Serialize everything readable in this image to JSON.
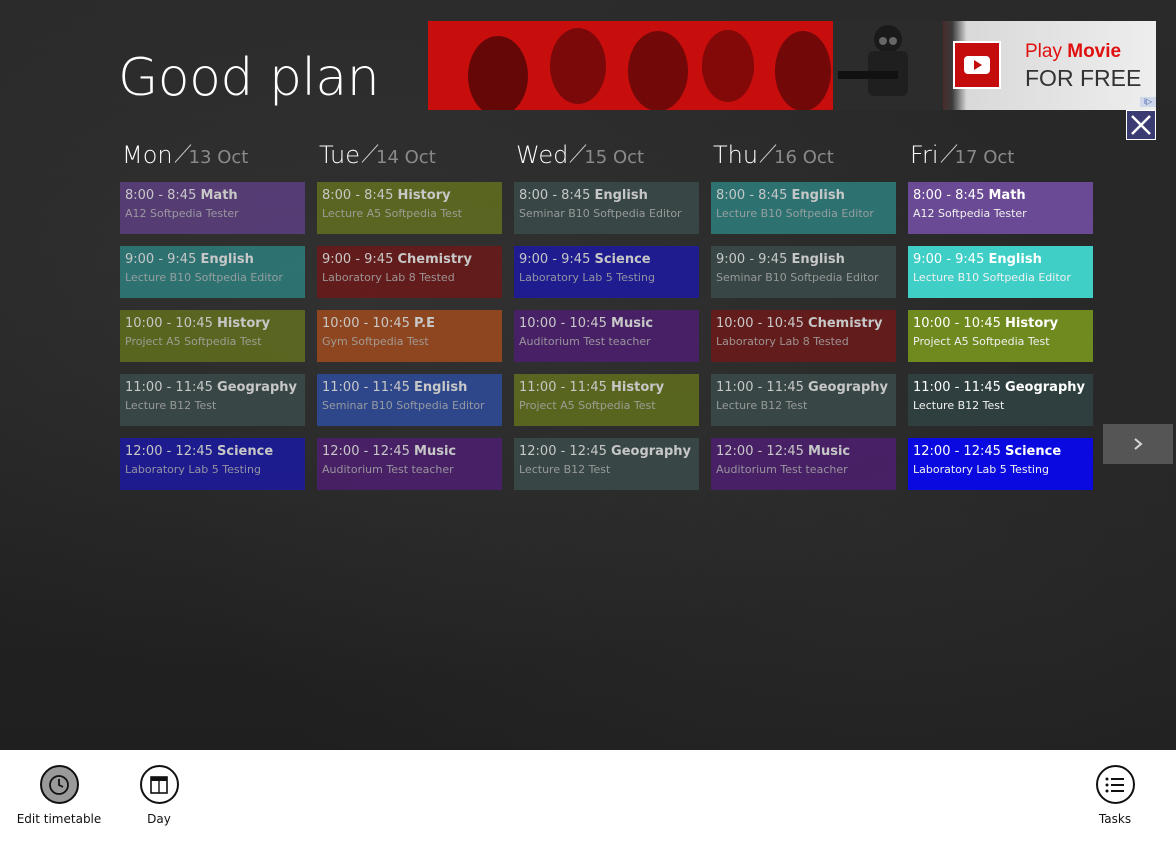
{
  "app": {
    "title": "Good plan"
  },
  "ad": {
    "line1_a": "Play",
    "line1_b": "Movie",
    "line2": "FOR FREE",
    "info_label": "i▷"
  },
  "days": [
    {
      "name": "Mon",
      "date": "13 Oct",
      "lessons": [
        {
          "time": "8:00 - 8:45",
          "subject": "Math",
          "details": "A12 Softpedia Tester",
          "color": "#5b3f7d"
        },
        {
          "time": "9:00 - 9:45",
          "subject": "English",
          "details": "Lecture B10 Softpedia Editor",
          "color": "#2e7b7b"
        },
        {
          "time": "10:00 - 10:45",
          "subject": "History",
          "details": "Project A5 Softpedia Test",
          "color": "#5f6d1e"
        },
        {
          "time": "11:00 - 11:45",
          "subject": "Geography",
          "details": "Lecture B12 Test",
          "color": "#3a4a4a"
        },
        {
          "time": "12:00 - 12:45",
          "subject": "Science",
          "details": "Laboratory Lab 5 Testing",
          "color": "#1c1a9c"
        }
      ]
    },
    {
      "name": "Tue",
      "date": "14 Oct",
      "lessons": [
        {
          "time": "8:00 - 8:45",
          "subject": "History",
          "details": "Lecture A5 Softpedia Test",
          "color": "#5f6d1e"
        },
        {
          "time": "9:00 - 9:45",
          "subject": "Chemistry",
          "details": "Laboratory Lab 8 Tested",
          "color": "#6b1a1a"
        },
        {
          "time": "10:00 - 10:45",
          "subject": "P.E",
          "details": "Gym Softpedia Test",
          "color": "#9a4a1e"
        },
        {
          "time": "11:00 - 11:45",
          "subject": "English",
          "details": "Seminar B10 Softpedia Editor",
          "color": "#2e4b97"
        },
        {
          "time": "12:00 - 12:45",
          "subject": "Music",
          "details": "Auditorium Test teacher",
          "color": "#4b1f6d"
        }
      ]
    },
    {
      "name": "Wed",
      "date": "15 Oct",
      "lessons": [
        {
          "time": "8:00 - 8:45",
          "subject": "English",
          "details": "Seminar B10 Softpedia Editor",
          "color": "#3a4a4a"
        },
        {
          "time": "9:00 - 9:45",
          "subject": "Science",
          "details": "Laboratory Lab 5 Testing",
          "color": "#1c1a9c"
        },
        {
          "time": "10:00 - 10:45",
          "subject": "Music",
          "details": "Auditorium Test teacher",
          "color": "#4b1f6d"
        },
        {
          "time": "11:00 - 11:45",
          "subject": "History",
          "details": "Project A5 Softpedia Test",
          "color": "#5f6d1e"
        },
        {
          "time": "12:00 - 12:45",
          "subject": "Geography",
          "details": "Lecture B12 Test",
          "color": "#3a4a4a"
        }
      ]
    },
    {
      "name": "Thu",
      "date": "16 Oct",
      "lessons": [
        {
          "time": "8:00 - 8:45",
          "subject": "English",
          "details": "Lecture B10 Softpedia Editor",
          "color": "#2e7b7b"
        },
        {
          "time": "9:00 - 9:45",
          "subject": "English",
          "details": "Seminar B10 Softpedia Editor",
          "color": "#3a4a4a"
        },
        {
          "time": "10:00 - 10:45",
          "subject": "Chemistry",
          "details": "Laboratory Lab 8 Tested",
          "color": "#6b1a1a"
        },
        {
          "time": "11:00 - 11:45",
          "subject": "Geography",
          "details": "Lecture B12 Test",
          "color": "#3a4a4a"
        },
        {
          "time": "12:00 - 12:45",
          "subject": "Music",
          "details": "Auditorium Test teacher",
          "color": "#4b1f6d"
        }
      ]
    },
    {
      "name": "Fri",
      "date": "17 Oct",
      "highlight": true,
      "lessons": [
        {
          "time": "8:00 - 8:45",
          "subject": "Math",
          "details": "A12 Softpedia Tester",
          "color": "#6a4a94"
        },
        {
          "time": "9:00 - 9:45",
          "subject": "English",
          "details": "Lecture B10 Softpedia Editor",
          "color": "#3fcfc6"
        },
        {
          "time": "10:00 - 10:45",
          "subject": "History",
          "details": "Project A5 Softpedia Test",
          "color": "#6f8a1e"
        },
        {
          "time": "11:00 - 11:45",
          "subject": "Geography",
          "details": "Lecture B12 Test",
          "color": "#2f3f3f"
        },
        {
          "time": "12:00 - 12:45",
          "subject": "Science",
          "details": "Laboratory Lab 5 Testing",
          "color": "#0a0ae0"
        }
      ]
    }
  ],
  "appbar": {
    "edit_timetable": "Edit timetable",
    "day": "Day",
    "tasks": "Tasks"
  }
}
